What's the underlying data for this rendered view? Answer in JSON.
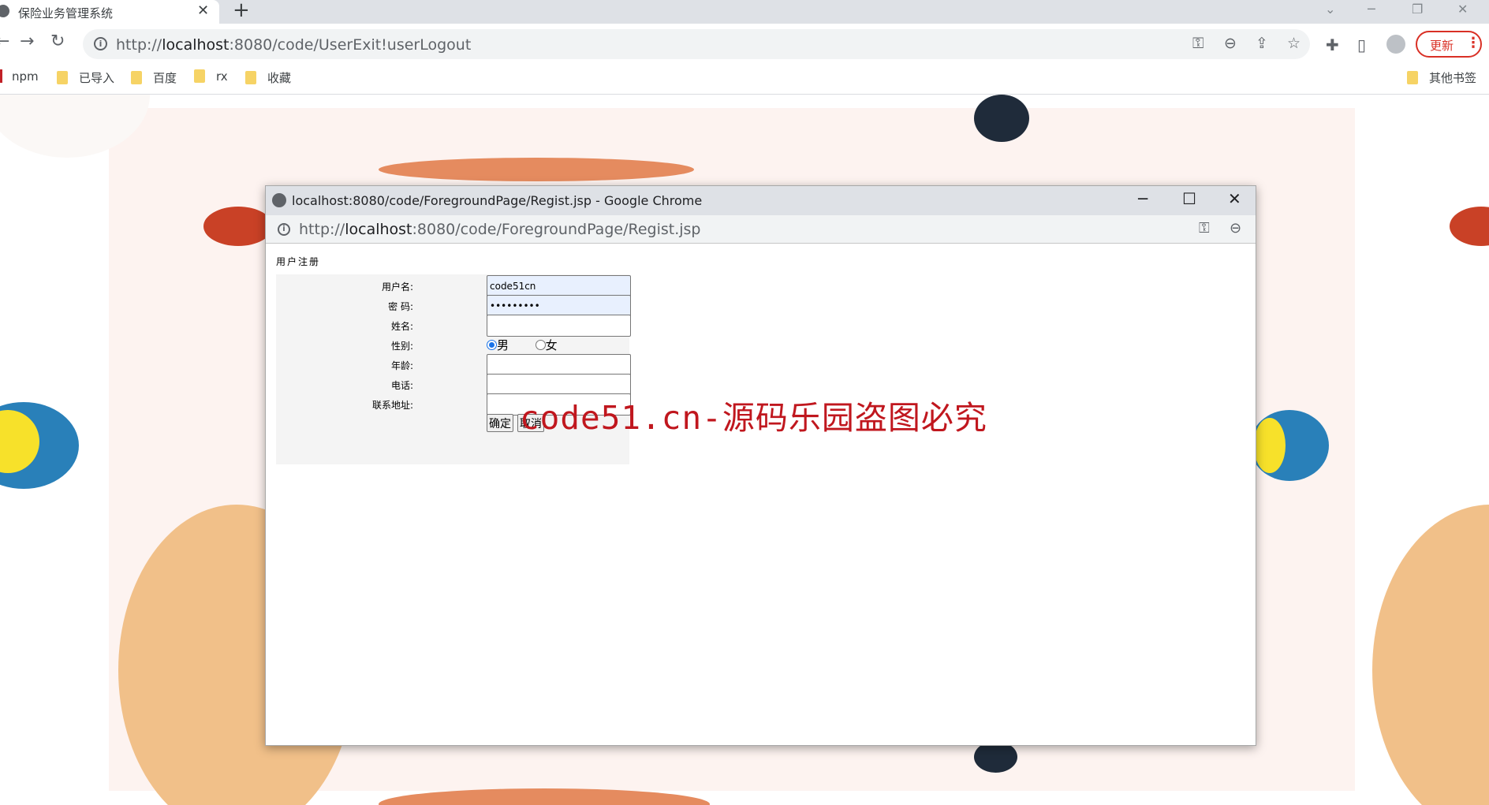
{
  "browser": {
    "tab_title": "保险业务管理系统",
    "tab_close": "✕",
    "new_tab": "+",
    "url_prefix": "http://",
    "url_host": "localhost",
    "url_rest": ":8080/code/UserExit!userLogout",
    "update_label": "更新",
    "update_menu": "⋮"
  },
  "bookmarks": [
    {
      "label": "npm"
    },
    {
      "label": "已导入"
    },
    {
      "label": "百度"
    },
    {
      "label": "rx"
    },
    {
      "label": "收藏"
    }
  ],
  "other_bookmarks": "其他书签",
  "popup": {
    "window_title": "localhost:8080/code/ForegroundPage/Regist.jsp - Google Chrome",
    "url_prefix": "http://",
    "url_host": "localhost",
    "url_rest": ":8080/code/ForegroundPage/Regist.jsp",
    "minimize": "─",
    "maximize": "☐",
    "close": "✕"
  },
  "form": {
    "heading": "用户注册",
    "fields": {
      "username": {
        "label": "用户名:",
        "value": "code51cn"
      },
      "password": {
        "label": "密 码:",
        "value": "•••••••••"
      },
      "name": {
        "label": "姓名:",
        "value": ""
      },
      "gender": {
        "label": "性别:",
        "options": [
          "男",
          "女"
        ],
        "selected": "男"
      },
      "age": {
        "label": "年龄:",
        "value": ""
      },
      "phone": {
        "label": "电话:",
        "value": ""
      },
      "address": {
        "label": "联系地址:",
        "value": ""
      }
    },
    "submit_label": "确定",
    "cancel_label": "取消"
  },
  "watermark": "code51.cn-源码乐园盗图必究"
}
